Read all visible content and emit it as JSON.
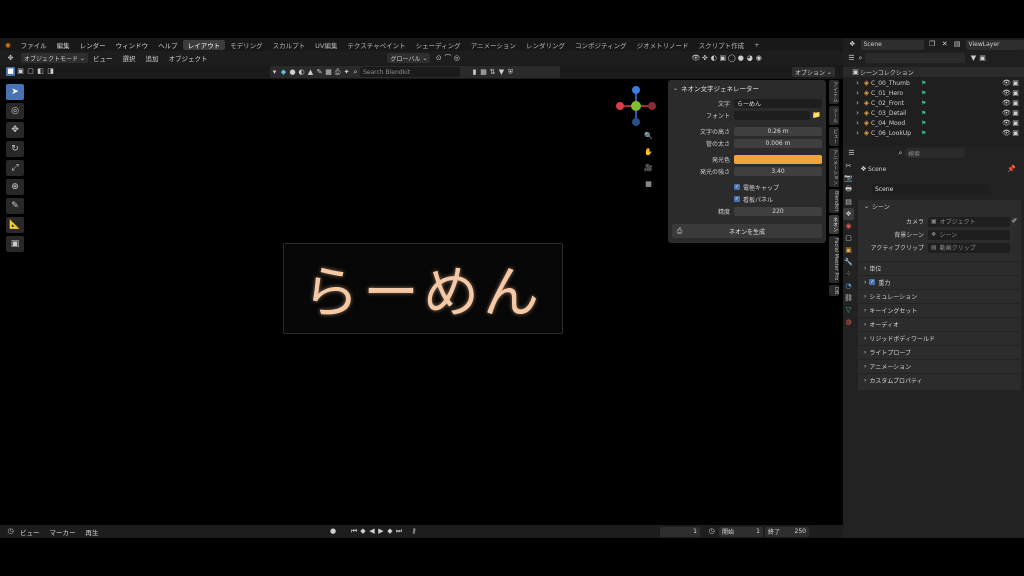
{
  "menu": {
    "items": [
      "ファイル",
      "編集",
      "レンダー",
      "ウィンドウ",
      "ヘルプ"
    ],
    "workspaces": [
      "レイアウト",
      "モデリング",
      "スカルプト",
      "UV編集",
      "テクスチャペイント",
      "シェーディング",
      "アニメーション",
      "レンダリング",
      "コンポジティング",
      "ジオメトリノード",
      "スクリプト作成"
    ],
    "active_workspace": "レイアウト",
    "add_tab": "+"
  },
  "topbar_right": {
    "scene": "Scene",
    "view_layer": "ViewLayer"
  },
  "viewport_header": {
    "mode": "オブジェクトモード",
    "menus": [
      "ビュー",
      "選択",
      "追加",
      "オブジェクト"
    ],
    "transform": "グローバル",
    "options": "オプション",
    "search_placeholder": "Search Blendkit"
  },
  "neon_text": "らーめん",
  "panel": {
    "title": "ネオン文字ジェネレーター",
    "text_label": "文字",
    "text_value": "らーめん",
    "font_label": "フォント",
    "font_value": "",
    "height_label": "文字の高さ",
    "height_value": "0.26 m",
    "tube_label": "管の太さ",
    "tube_value": "0.006 m",
    "emit_color_label": "発光色",
    "emit_color": "#f0a53c",
    "emit_strength_label": "発光の強さ",
    "emit_strength_value": "3.40",
    "endcap_label": "電極キャップ",
    "backboard_label": "看板パネル",
    "precision_label": "精度",
    "precision_value": "220",
    "generate_label": "ネオンを生成"
  },
  "side_tabs": [
    "アイテム",
    "ツール",
    "ビュー",
    "アニメーション",
    "Blendkit",
    "ネオン",
    "Facial Master Pro",
    "DB"
  ],
  "timeline": {
    "menus": [
      "ビュー",
      "マーカー",
      "再生"
    ],
    "current_frame": "1",
    "start_label": "開始",
    "start": "1",
    "end_label": "終了",
    "end": "250"
  },
  "outliner": {
    "root": "シーンコレクション",
    "items": [
      "C_00_Thumb",
      "C_01_Hero",
      "C_02_Front",
      "C_03_Detail",
      "C_04_Mood",
      "C_06_LookUp"
    ]
  },
  "properties": {
    "search_placeholder": "検索",
    "header_scene": "Scene",
    "scene_field": "Scene",
    "section_scene": "シーン",
    "camera_label": "カメラ",
    "camera_placeholder": "オブジェクト",
    "bg_label": "背景シーン",
    "bg_placeholder": "シーン",
    "clip_label": "アクティブクリップ",
    "clip_placeholder": "動画クリップ",
    "sections": [
      "単位",
      "重力",
      "シミュレーション",
      "キーイングセット",
      "オーディオ",
      "リジッドボディワールド",
      "ライトプローブ",
      "アニメーション",
      "カスタムプロパティ"
    ]
  },
  "colors": {
    "accent": "#4772b3",
    "neon": "#f6c9a6",
    "emit": "#f0a53c"
  }
}
